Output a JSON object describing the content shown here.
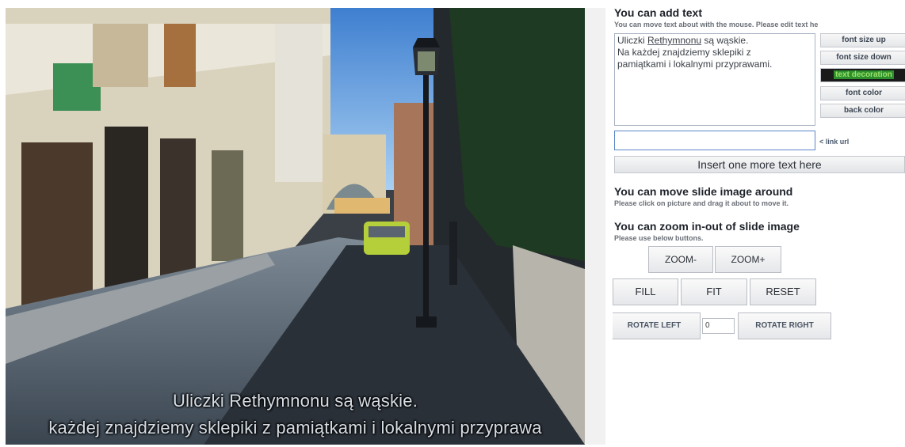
{
  "photo": {
    "overlay_lines": [
      "Uliczki Rethymnonu są wąskie.",
      "każdej znajdziemy sklepiki z pamiątkami i  lokalnymi przyprawa"
    ]
  },
  "panel": {
    "add_text": {
      "heading": "You can add text",
      "hint": "You can move text about with the mouse. Please edit text he",
      "textarea_lines": [
        "Uliczki Rethymnonu są wąskie.",
        " Na każdej znajdziemy sklepiki z",
        "pamiątkami i  lokalnymi przyprawami."
      ],
      "buttons": {
        "font_size_up": "font size up",
        "font_size_down": "font size down",
        "text_decoration": "text decoration",
        "font_color": "font color",
        "back_color": "back color"
      },
      "link_input_value": "",
      "link_label": "< link url",
      "insert_button": "Insert one more text here"
    },
    "move": {
      "heading": "You can move slide image around",
      "hint": "Please click on picture and drag it about to move it."
    },
    "zoom": {
      "heading": "You can zoom in-out of slide image",
      "hint": "Please use below buttons.",
      "zoom_out": "ZOOM-",
      "zoom_in": "ZOOM+",
      "fill": "FILL",
      "fit": "FIT",
      "reset": "RESET",
      "rotate_left": "ROTATE LEFT",
      "rotate_value": "0",
      "rotate_right": "ROTATE RIGHT"
    }
  }
}
